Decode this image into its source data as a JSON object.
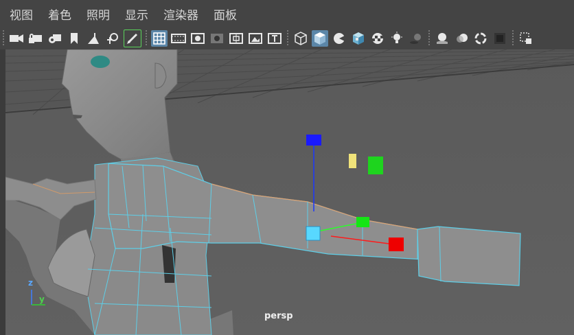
{
  "menu": [
    "视图",
    "着色",
    "照明",
    "显示",
    "渲染器",
    "面板"
  ],
  "toolbar_icons": [
    "camera-icon",
    "camera-lock-icon",
    "camera-attributes-icon",
    "bookmark-icon",
    "grid-snap-icon",
    "move-pivot-icon",
    "pencil-icon",
    "grid-icon",
    "film-gate-icon",
    "resolution-gate-icon",
    "gate-mask-icon",
    "field-chart-icon",
    "safe-action-icon",
    "safe-title-icon",
    "wireframe-icon",
    "smooth-shade-icon",
    "default-material-icon",
    "textured-icon",
    "checker-icon",
    "lights-icon",
    "shadows-icon",
    "screen-space-ao-icon",
    "motion-blur-icon",
    "anti-alias-icon",
    "depth-of-field-icon",
    "isolate-select-icon"
  ],
  "viewport": {
    "camera_label": "persp",
    "axis_labels": {
      "z": "z",
      "y": "y"
    }
  }
}
